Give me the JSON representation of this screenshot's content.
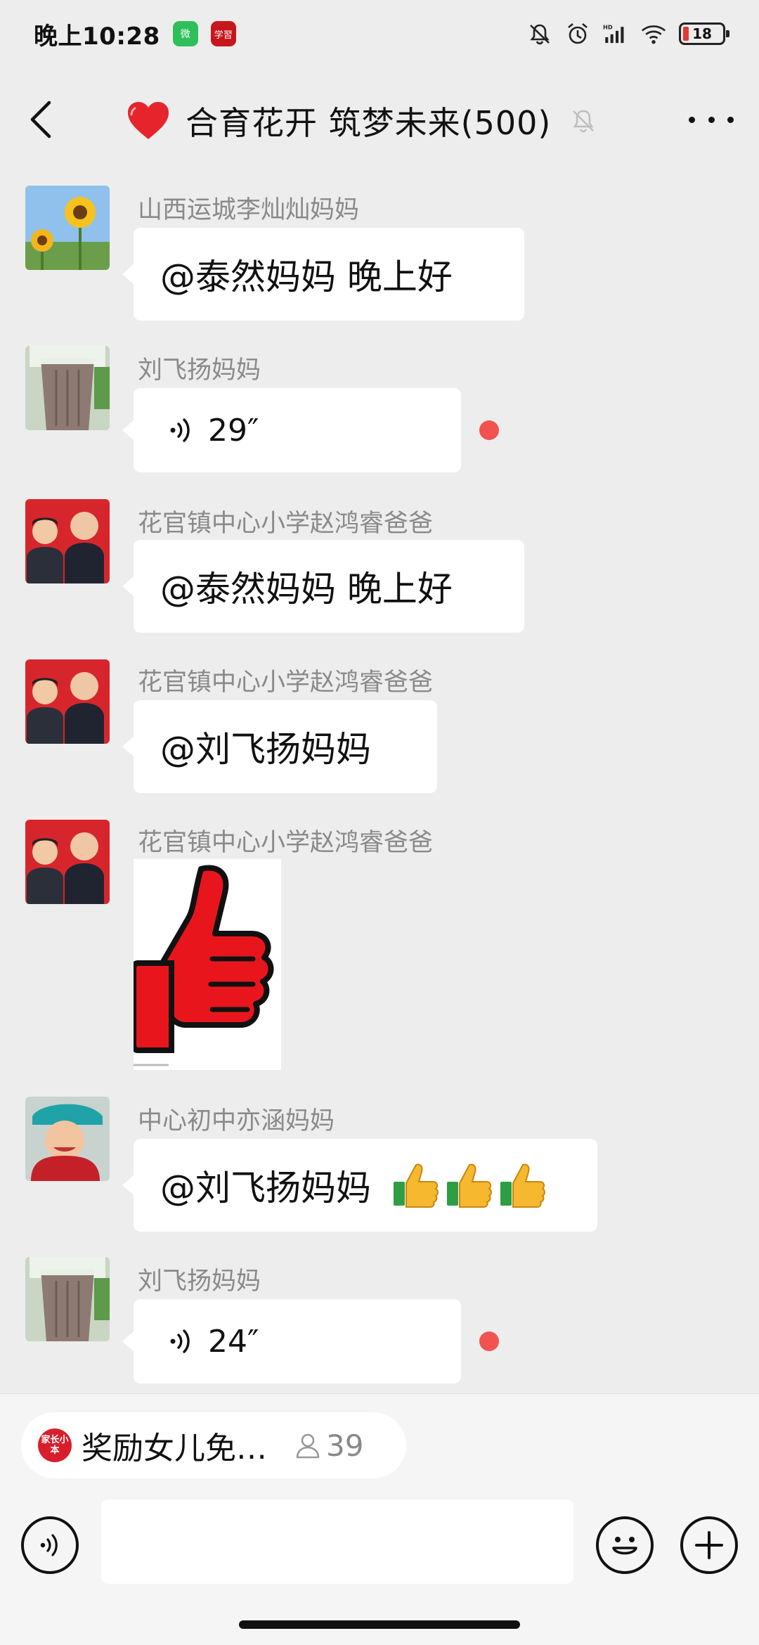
{
  "status_bar": {
    "time": "晚上10:28",
    "wechat_badge": "微",
    "study_badge": "学習",
    "network_label": "HD",
    "battery": "18"
  },
  "header": {
    "title": "合育花开 筑梦未来(500)"
  },
  "messages": [
    {
      "sender": "山西运城李灿灿妈妈",
      "type": "text",
      "text": "@泰然妈妈  晚上好"
    },
    {
      "sender": "刘飞扬妈妈",
      "type": "voice",
      "duration": "29″",
      "unread": true
    },
    {
      "sender": "花官镇中心小学赵鸿睿爸爸",
      "type": "text",
      "text": "@泰然妈妈  晚上好"
    },
    {
      "sender": "花官镇中心小学赵鸿睿爸爸",
      "type": "text",
      "text": "@刘飞扬妈妈"
    },
    {
      "sender": "花官镇中心小学赵鸿睿爸爸",
      "type": "sticker",
      "sticker": "thumbs-up"
    },
    {
      "sender": "中心初中亦涵妈妈",
      "type": "text",
      "text": "@刘飞扬妈妈"
    },
    {
      "sender": "刘飞扬妈妈",
      "type": "voice",
      "duration": "24″",
      "unread": true
    }
  ],
  "live_pill": {
    "logo_text": "家长小本",
    "title": "奖励女儿免…",
    "count": "39"
  },
  "colors": {
    "background": "#ededed",
    "unread_dot": "#f25350",
    "heart": "#e5242b"
  }
}
